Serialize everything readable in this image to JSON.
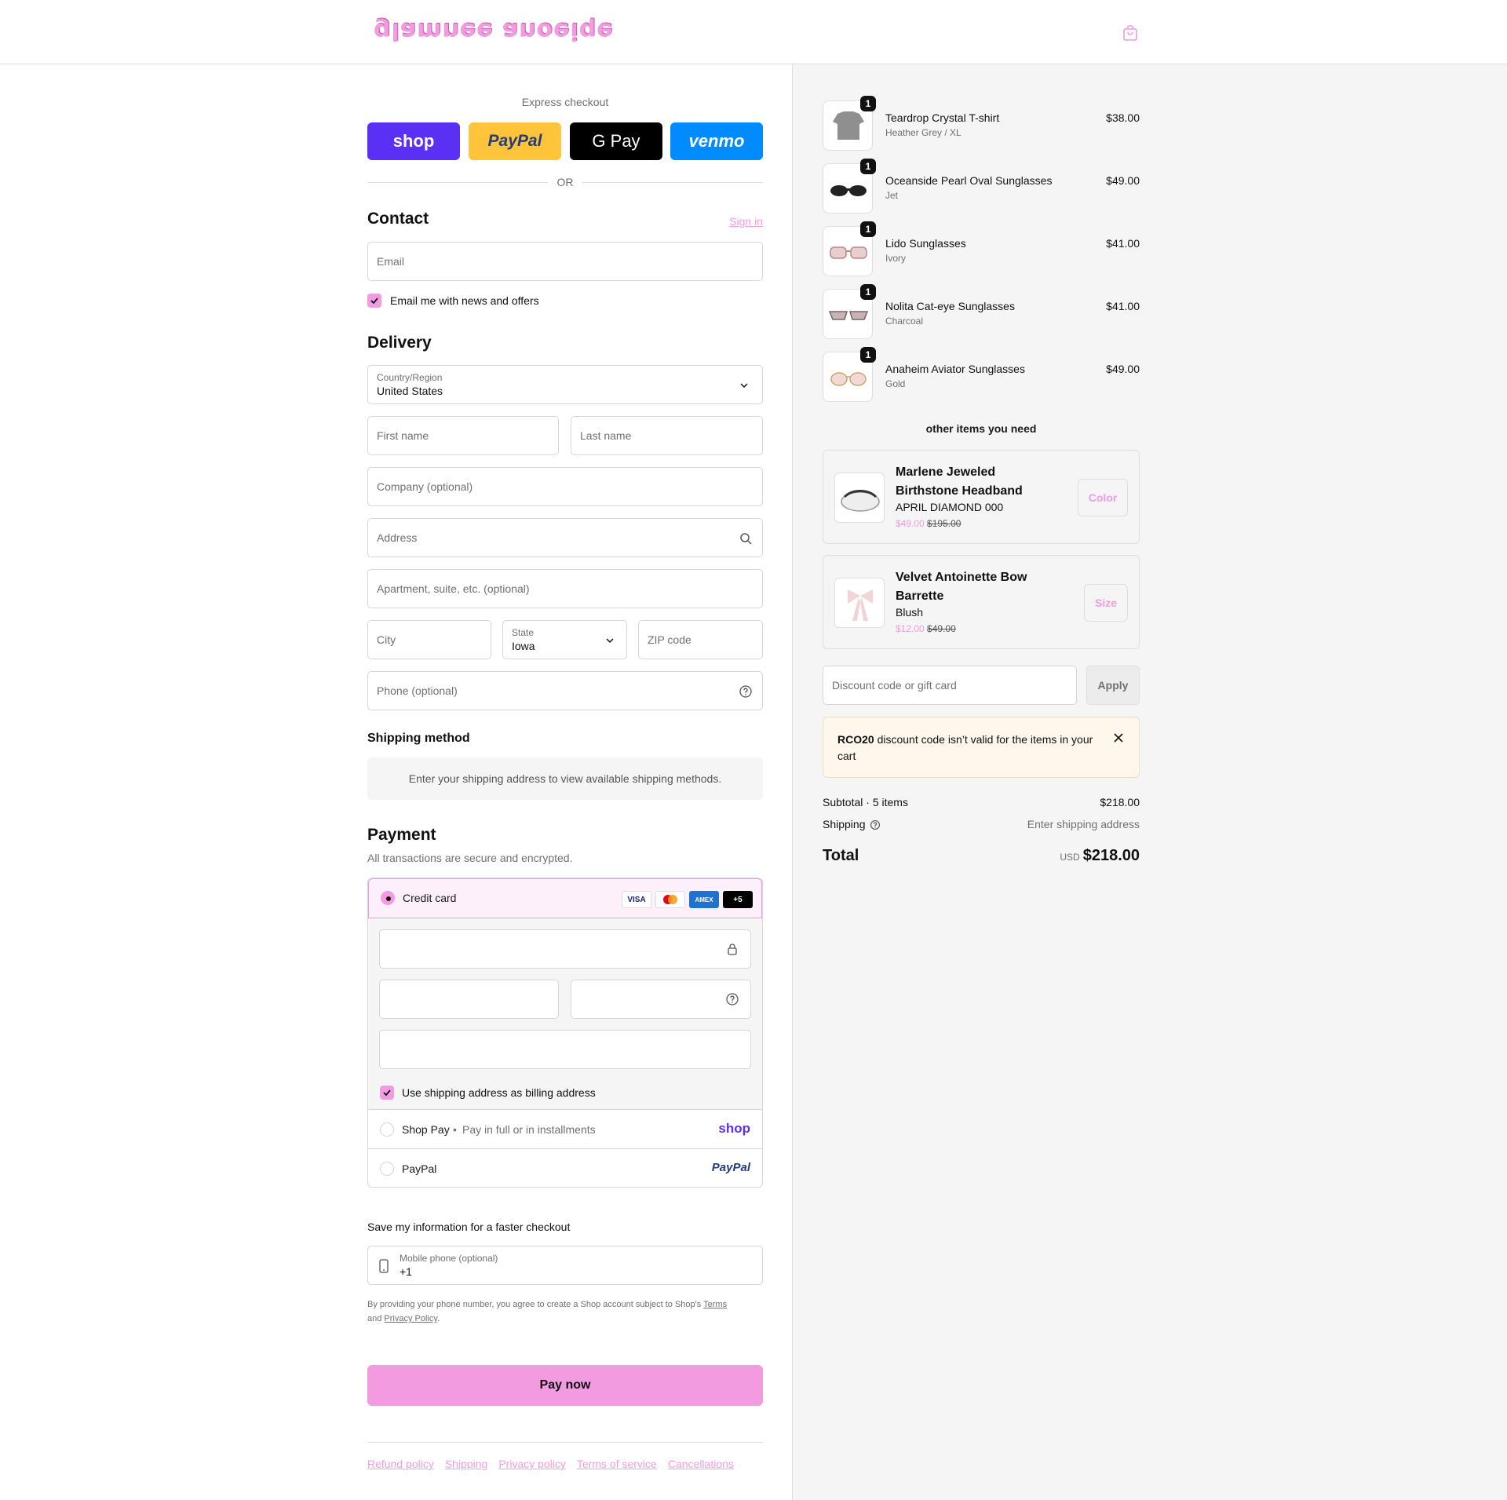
{
  "header": {
    "logo_text": "glamnee anoeiqe",
    "cart_icon": "shopping-bag-icon"
  },
  "express": {
    "label": "Express checkout",
    "buttons": [
      "shop",
      "PayPal",
      "G Pay",
      "venmo"
    ],
    "or": "OR"
  },
  "contact": {
    "title": "Contact",
    "sign_in": "Sign in",
    "email_placeholder": "Email",
    "news_label": "Email me with news and offers"
  },
  "delivery": {
    "title": "Delivery",
    "country_label": "Country/Region",
    "country_value": "United States",
    "first_name": "First name",
    "last_name": "Last name",
    "company": "Company (optional)",
    "address": "Address",
    "apartment": "Apartment, suite, etc. (optional)",
    "city": "City",
    "state_label": "State",
    "state_value": "Iowa",
    "zip": "ZIP code",
    "phone": "Phone (optional)"
  },
  "shipping": {
    "title": "Shipping method",
    "message": "Enter your shipping address to view available shipping methods."
  },
  "payment": {
    "title": "Payment",
    "subtitle": "All transactions are secure and encrypted.",
    "credit_card": "Credit card",
    "brands": [
      "VISA",
      "MC",
      "AMEX",
      "+5"
    ],
    "billing_label": "Use shipping address as billing address",
    "shop_pay": "Shop Pay",
    "shop_pay_sub": "Pay in full or in installments",
    "shop_pay_logo": "shop",
    "paypal": "PayPal",
    "paypal_logo": "PayPal"
  },
  "save_info": {
    "title": "Save my information for a faster checkout",
    "mobile_label": "Mobile phone (optional)",
    "mobile_value": "+1",
    "legal_1": "By providing your phone number, you agree to create a Shop account subject to Shop's ",
    "terms": "Terms",
    "legal_and": "and ",
    "privacy": "Privacy Policy",
    "legal_end": "."
  },
  "pay_now": "Pay now",
  "footer_links": [
    "Refund policy",
    "Shipping",
    "Privacy policy",
    "Terms of service",
    "Cancellations"
  ],
  "cart": {
    "items": [
      {
        "name": "Teardrop Crystal T-shirt",
        "variant": "Heather Grey / XL",
        "price": "$38.00",
        "qty": "1"
      },
      {
        "name": "Oceanside Pearl Oval Sunglasses",
        "variant": "Jet",
        "price": "$49.00",
        "qty": "1"
      },
      {
        "name": "Lido Sunglasses",
        "variant": "Ivory",
        "price": "$41.00",
        "qty": "1"
      },
      {
        "name": "Nolita Cat-eye Sunglasses",
        "variant": "Charcoal",
        "price": "$41.00",
        "qty": "1"
      },
      {
        "name": "Anaheim Aviator Sunglasses",
        "variant": "Gold",
        "price": "$49.00",
        "qty": "1"
      }
    ],
    "upsell_title": "other items you need",
    "upsells": [
      {
        "name": "Marlene Jeweled Birthstone Headband",
        "variant": "APRIL DIAMOND 000",
        "price": "$49.00",
        "compare": "$195.00",
        "button": "Color"
      },
      {
        "name": "Velvet Antoinette Bow Barrette",
        "variant": "Blush",
        "price": "$12.00",
        "compare": "$49.00",
        "button": "Size"
      }
    ],
    "discount_placeholder": "Discount code or gift card",
    "apply": "Apply",
    "error_code": "RCO20",
    "error_msg": " discount code isn’t valid for the items in your cart",
    "subtotal_label": "Subtotal · 5 items",
    "subtotal": "$218.00",
    "shipping_label": "Shipping",
    "shipping_value": "Enter shipping address",
    "total_label": "Total",
    "currency": "USD",
    "total": "$218.00"
  },
  "colors": {
    "accent": "#f29be0",
    "shop": "#5a31f4",
    "paypal": "#ffc439",
    "venmo": "#008cff"
  }
}
